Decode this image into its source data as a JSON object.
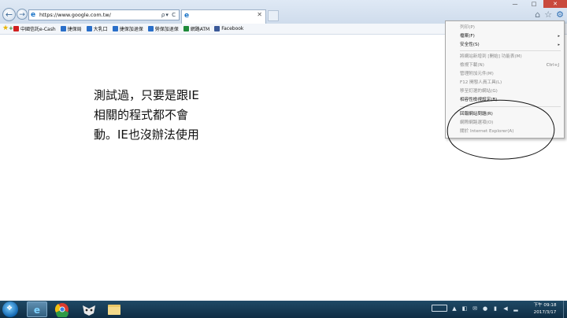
{
  "browser": {
    "background_tabs": [
      "",
      "",
      "",
      ""
    ],
    "address_url": "https://www.google.com.tw/",
    "address_tools": "ρ▾ C",
    "active_tab_title": "",
    "tab_close": "✕",
    "window_controls": [
      "—",
      "□",
      "✕"
    ]
  },
  "favorites": [
    {
      "label": "中國信託e-Cash",
      "icon_color": "#d02020"
    },
    {
      "label": "捷保局",
      "icon_color": "#2a6fc9"
    },
    {
      "label": "大乳口",
      "icon_color": "#2a6fc9"
    },
    {
      "label": "捷保加退保",
      "icon_color": "#2a6fc9"
    },
    {
      "label": "勞保加退保",
      "icon_color": "#2a6fc9"
    },
    {
      "label": "網路ATM",
      "icon_color": "#1f8a3a"
    },
    {
      "label": "Facebook",
      "icon_color": "#3b5998"
    }
  ],
  "page": {
    "lines": [
      "測試過，只要是跟IE",
      "相關的程式都不會",
      "動。IE也沒辦法使用"
    ]
  },
  "tools_menu": {
    "items": [
      {
        "label": "列印(P)",
        "disabled": true
      },
      {
        "label": "檔案(F)",
        "disabled": false,
        "submenu": true
      },
      {
        "label": "安全性(S)",
        "disabled": false,
        "submenu": true
      },
      {
        "label": "將網站新增到 [開始] 功能表(M)",
        "disabled": true
      },
      {
        "label": "檢視下載(N)",
        "disabled": true,
        "shortcut": "Ctrl+J"
      },
      {
        "label": "管理附加元件(M)",
        "disabled": true
      },
      {
        "label": "F12 開發人員工具(L)",
        "disabled": true
      },
      {
        "label": "移至釘選的網站(G)",
        "disabled": true
      },
      {
        "label": "相容性檢視設定(B)",
        "disabled": false
      },
      {
        "label": "回報網站問題(R)",
        "disabled": false
      },
      {
        "label": "網際網路選項(O)",
        "disabled": true
      },
      {
        "label": "關於 Internet Explorer(A)",
        "disabled": true
      }
    ],
    "arrow": "▸"
  },
  "taskbar": {
    "clock_time": "下午 09:18",
    "clock_date": "2017/3/17"
  },
  "icons": {
    "back": "←",
    "forward": "→",
    "home": "⌂",
    "favorites": "☆",
    "settings": "⚙",
    "windows": "❖"
  }
}
